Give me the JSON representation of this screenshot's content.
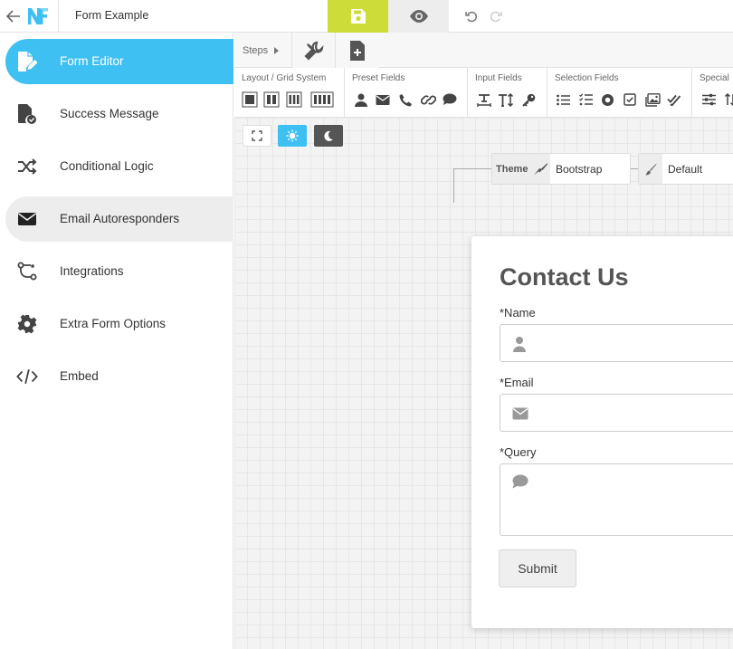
{
  "header": {
    "title": "Form Example",
    "logo_text": "NF",
    "colors": {
      "save_bg": "#cddc39",
      "preview_bg": "#ededed"
    },
    "icons": [
      "back-arrow-icon",
      "save-icon",
      "eye-icon",
      "undo-icon",
      "redo-icon"
    ]
  },
  "sidebar": {
    "items": [
      {
        "label": "Form Editor",
        "icon": "form-edit-icon",
        "state": "active"
      },
      {
        "label": "Success Message",
        "icon": "file-check-icon",
        "state": "normal"
      },
      {
        "label": "Conditional Logic",
        "icon": "shuffle-icon",
        "state": "normal"
      },
      {
        "label": "Email Autoresponders",
        "icon": "envelope-icon",
        "state": "hover"
      },
      {
        "label": "Integrations",
        "icon": "integration-icon",
        "state": "normal"
      },
      {
        "label": "Extra Form Options",
        "icon": "gear-icon",
        "state": "normal"
      },
      {
        "label": "Embed",
        "icon": "code-icon",
        "state": "normal"
      }
    ],
    "accent": "#3fc0f2"
  },
  "steps": {
    "label": "Steps",
    "tabs": [
      "tools-icon",
      "add-page-icon"
    ]
  },
  "toolbar": {
    "groups": [
      {
        "title": "Layout / Grid System",
        "buttons": [
          "grid-1-icon",
          "grid-2-icon",
          "grid-3-icon",
          "grid-4-icon"
        ]
      },
      {
        "title": "Preset Fields",
        "buttons": [
          "user-icon",
          "envelope-icon",
          "phone-icon",
          "link-icon",
          "comment-icon"
        ]
      },
      {
        "title": "Input Fields",
        "buttons": [
          "text-field-icon",
          "text-height-icon",
          "key-icon"
        ]
      },
      {
        "title": "Selection Fields",
        "buttons": [
          "list-icon",
          "checklist-icon",
          "radio-icon",
          "checkbox-icon",
          "image-select-icon",
          "double-check-icon"
        ]
      },
      {
        "title": "Special",
        "buttons": [
          "sliders-icon",
          "sort-icon"
        ]
      }
    ]
  },
  "canvas_controls": [
    "expand-icon",
    "sun-icon",
    "moon-icon"
  ],
  "theme": {
    "tag_label": "Theme",
    "value": "Bootstrap",
    "style_value": "Default"
  },
  "form": {
    "heading": "Contact Us",
    "fields": [
      {
        "label": "*Name",
        "icon": "user-icon",
        "value": ""
      },
      {
        "label": "*Email",
        "icon": "envelope-icon",
        "value": ""
      },
      {
        "label": "*Query",
        "icon": "comment-icon",
        "value": ""
      }
    ],
    "submit_label": "Submit"
  }
}
